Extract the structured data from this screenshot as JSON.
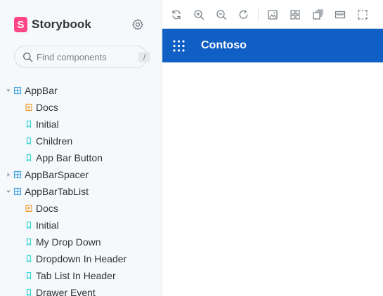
{
  "brand": {
    "name": "Storybook",
    "mark": "S",
    "mark_color": "#ff4785"
  },
  "search": {
    "placeholder": "Find components",
    "shortcut": "/"
  },
  "tree": [
    {
      "type": "component",
      "label": "AppBar",
      "expanded": true
    },
    {
      "type": "docs",
      "label": "Docs"
    },
    {
      "type": "story",
      "label": "Initial"
    },
    {
      "type": "story",
      "label": "Children"
    },
    {
      "type": "story",
      "label": "App Bar Button"
    },
    {
      "type": "component",
      "label": "AppBarSpacer",
      "expanded": false
    },
    {
      "type": "component",
      "label": "AppBarTabList",
      "expanded": true
    },
    {
      "type": "docs",
      "label": "Docs"
    },
    {
      "type": "story",
      "label": "Initial"
    },
    {
      "type": "story",
      "label": "My Drop Down"
    },
    {
      "type": "story",
      "label": "Dropdown In Header"
    },
    {
      "type": "story",
      "label": "Tab List In Header"
    },
    {
      "type": "story",
      "label": "Drawer Event"
    }
  ],
  "toolbar": {
    "buttons": [
      "reload-icon",
      "zoom-in-icon",
      "zoom-out-icon",
      "reset-zoom-icon",
      "background-icon",
      "grid-icon",
      "outline-icon",
      "viewport-icon",
      "measure-icon"
    ]
  },
  "preview": {
    "appbar_title": "Contoso",
    "appbar_color": "#0f5fc5"
  },
  "colors": {
    "component_icon": "#4aa3df",
    "docs_icon": "#f09a2e",
    "story_icon": "#37d5d3",
    "sidebar_bg": "#f6f9fc"
  }
}
